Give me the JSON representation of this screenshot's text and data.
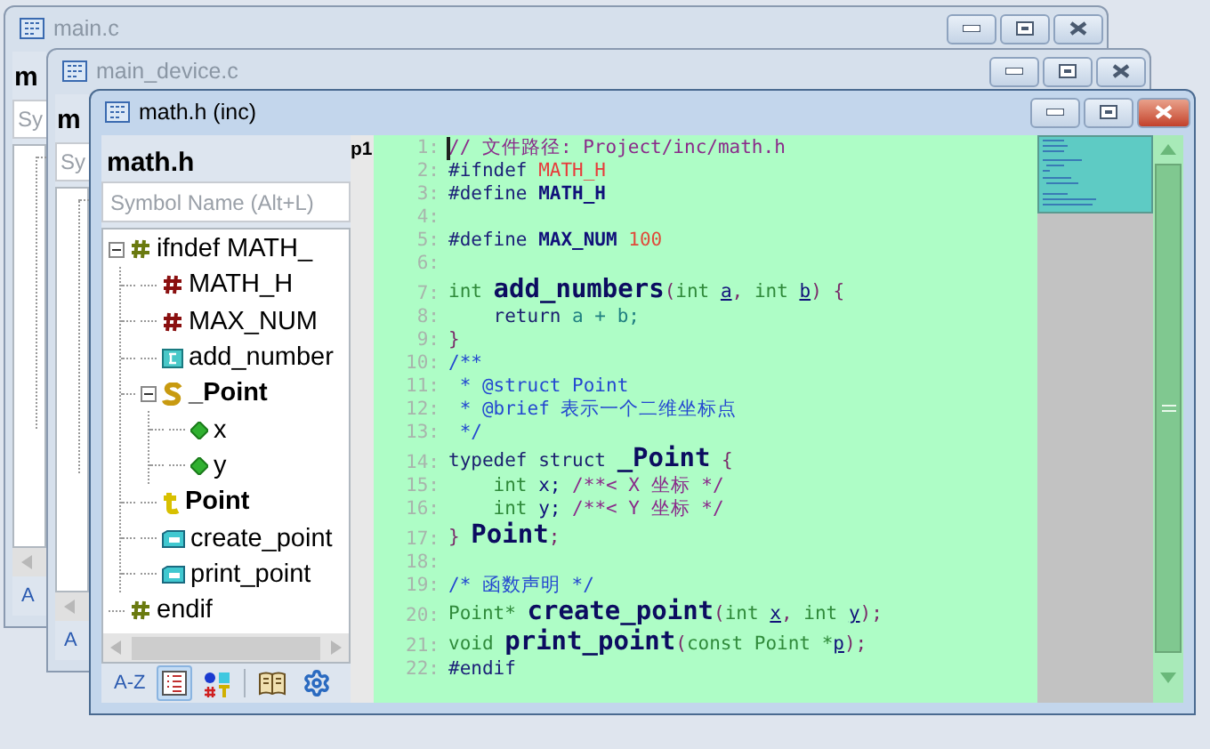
{
  "windows": [
    {
      "title": "main.c",
      "active": false,
      "panel": {
        "heading": "m",
        "search_placeholder": "Sy",
        "toolbar_label": "A"
      }
    },
    {
      "title": "main_device.c",
      "active": false,
      "panel": {
        "heading": "m",
        "search_placeholder": "Sy",
        "toolbar_label": "A"
      }
    },
    {
      "title": "math.h (inc)",
      "active": true,
      "panel": {
        "heading": "math.h",
        "search_placeholder": "Symbol Name (Alt+L)",
        "tree": [
          {
            "label": "ifndef MATH_",
            "kind": "conditional",
            "expanded": true,
            "children": [
              {
                "label": "MATH_H",
                "kind": "macro"
              },
              {
                "label": "MAX_NUM",
                "kind": "macro"
              },
              {
                "label": "add_number",
                "kind": "function"
              },
              {
                "label": "_Point",
                "kind": "struct",
                "expanded": true,
                "children": [
                  {
                    "label": "x",
                    "kind": "member"
                  },
                  {
                    "label": "y",
                    "kind": "member"
                  }
                ]
              },
              {
                "label": "Point",
                "kind": "typedef"
              },
              {
                "label": "create_point",
                "kind": "prototype"
              },
              {
                "label": "print_point",
                "kind": "prototype"
              }
            ]
          },
          {
            "label": "endif",
            "kind": "conditional"
          }
        ],
        "toolbar": [
          {
            "kind": "sort",
            "label": "A-Z",
            "selected": false
          },
          {
            "kind": "list",
            "selected": true
          },
          {
            "kind": "category",
            "selected": false
          },
          {
            "kind": "book",
            "selected": false
          },
          {
            "kind": "settings",
            "selected": false
          }
        ]
      },
      "editor": {
        "side_label": "p1",
        "lines": [
          {
            "number": "1:",
            "tokens": [
              {
                "kind": "comment",
                "text": "// 文件路径: Project/inc/math.h"
              }
            ]
          },
          {
            "number": "2:",
            "tokens": [
              {
                "kind": "pp",
                "text": "#ifndef "
              },
              {
                "kind": "macro_ref",
                "text": "MATH_H"
              }
            ]
          },
          {
            "number": "3:",
            "tokens": [
              {
                "kind": "pp",
                "text": "#define "
              },
              {
                "kind": "macro_def",
                "text": "MATH_H"
              }
            ]
          },
          {
            "number": "4:"
          },
          {
            "number": "5:",
            "tokens": [
              {
                "kind": "pp",
                "text": "#define "
              },
              {
                "kind": "macro_def",
                "text": "MAX_NUM"
              },
              {
                "kind": "number",
                "text": " 100"
              }
            ]
          },
          {
            "number": "6:"
          },
          {
            "number": "7:",
            "tokens": [
              {
                "kind": "type",
                "text": "int "
              },
              {
                "kind": "func",
                "text": "add_numbers"
              },
              {
                "kind": "punct",
                "text": "("
              },
              {
                "kind": "type",
                "text": "int "
              },
              {
                "kind": "param",
                "text": "a"
              },
              {
                "kind": "punct",
                "text": ", "
              },
              {
                "kind": "type",
                "text": "int "
              },
              {
                "kind": "param",
                "text": "b"
              },
              {
                "kind": "punct",
                "text": ") {"
              }
            ]
          },
          {
            "number": "8:",
            "tokens": [
              {
                "kind": "keyword",
                "text": "    return"
              },
              {
                "kind": "var",
                "text": " a + b;"
              }
            ]
          },
          {
            "number": "9:",
            "tokens": [
              {
                "kind": "punct",
                "text": "}"
              }
            ]
          },
          {
            "number": "10:",
            "tokens": [
              {
                "kind": "doc",
                "text": "/**"
              }
            ]
          },
          {
            "number": "11:",
            "tokens": [
              {
                "kind": "doc",
                "text": " * @struct Point"
              }
            ]
          },
          {
            "number": "12:",
            "tokens": [
              {
                "kind": "doc",
                "text": " * @brief 表示一个二维坐标点"
              }
            ]
          },
          {
            "number": "13:",
            "tokens": [
              {
                "kind": "doc",
                "text": " */"
              }
            ]
          },
          {
            "number": "14:",
            "tokens": [
              {
                "kind": "keyword",
                "text": "typedef struct "
              },
              {
                "kind": "func",
                "text": "_Point"
              },
              {
                "kind": "punct",
                "text": " {"
              }
            ]
          },
          {
            "number": "15:",
            "tokens": [
              {
                "kind": "type",
                "text": "    int "
              },
              {
                "kind": "plain",
                "text": "x; "
              },
              {
                "kind": "comment",
                "text": "/**< X 坐标 */"
              }
            ]
          },
          {
            "number": "16:",
            "tokens": [
              {
                "kind": "type",
                "text": "    int "
              },
              {
                "kind": "plain",
                "text": "y; "
              },
              {
                "kind": "comment",
                "text": "/**< Y 坐标 */"
              }
            ]
          },
          {
            "number": "17:",
            "tokens": [
              {
                "kind": "punct",
                "text": "} "
              },
              {
                "kind": "func",
                "text": "Point"
              },
              {
                "kind": "punct",
                "text": ";"
              }
            ]
          },
          {
            "number": "18:"
          },
          {
            "number": "19:",
            "tokens": [
              {
                "kind": "doc",
                "text": "/* 函数声明 */"
              }
            ]
          },
          {
            "number": "20:",
            "tokens": [
              {
                "kind": "type",
                "text": "Point* "
              },
              {
                "kind": "func",
                "text": "create_point"
              },
              {
                "kind": "punct",
                "text": "("
              },
              {
                "kind": "type",
                "text": "int "
              },
              {
                "kind": "param",
                "text": "x"
              },
              {
                "kind": "punct",
                "text": ", "
              },
              {
                "kind": "type",
                "text": "int "
              },
              {
                "kind": "param",
                "text": "y"
              },
              {
                "kind": "punct",
                "text": ");"
              }
            ]
          },
          {
            "number": "21:",
            "tokens": [
              {
                "kind": "type",
                "text": "void "
              },
              {
                "kind": "func",
                "text": "print_point"
              },
              {
                "kind": "punct",
                "text": "("
              },
              {
                "kind": "type",
                "text": "const Point *"
              },
              {
                "kind": "param",
                "text": "p"
              },
              {
                "kind": "punct",
                "text": ");"
              }
            ]
          },
          {
            "number": "22:",
            "tokens": [
              {
                "kind": "pp",
                "text": "#endif"
              }
            ]
          }
        ]
      }
    }
  ]
}
